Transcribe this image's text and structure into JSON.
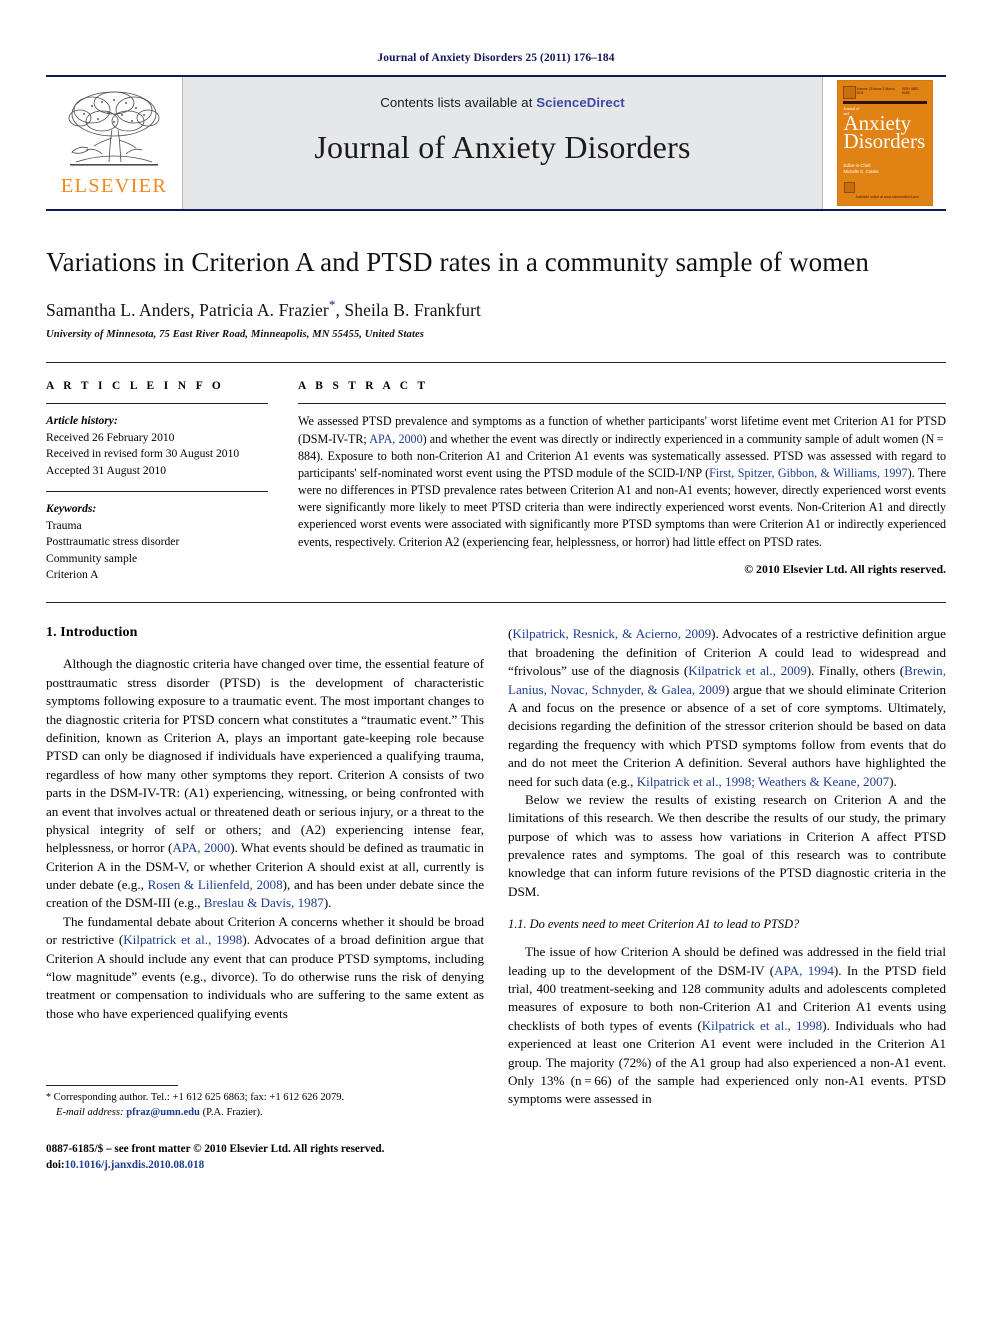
{
  "running_head": "Journal of Anxiety Disorders 25 (2011) 176–184",
  "masthead": {
    "contents_prefix": "Contents lists available at ",
    "sciencedirect": "ScienceDirect",
    "journal_title": "Journal of Anxiety Disorders",
    "publisher_logo_text": "ELSEVIER",
    "cover": {
      "top_left_meta": "Volume 25 Issue 2 March 2011",
      "top_right_meta": "ISSN 0887-6185",
      "kicker_line1": "Journal of",
      "kicker_line2": "and",
      "big_line1": "Anxiety",
      "big_line2": "Disorders",
      "editor_label": "Editor-in-Chief:",
      "editor_name": "Michelle G. Craske",
      "footer_text": "Available online at www.sciencedirect.com"
    }
  },
  "article": {
    "title": "Variations in Criterion A and PTSD rates in a community sample of women",
    "authors": "Samantha L. Anders, Patricia A. Frazier",
    "authors_tail": ", Sheila B. Frankfurt",
    "corresponding_marker": "*",
    "affiliation": "University of Minnesota, 75 East River Road, Minneapolis, MN 55455, United States"
  },
  "info": {
    "heading": "A R T I C L E  I N F O",
    "history_label": "Article history:",
    "history": [
      "Received 26 February 2010",
      "Received in revised form 30 August 2010",
      "Accepted 31 August 2010"
    ],
    "keywords_label": "Keywords:",
    "keywords": [
      "Trauma",
      "Posttraumatic stress disorder",
      "Community sample",
      "Criterion A"
    ]
  },
  "abstract": {
    "heading": "A B S T R A C T",
    "paragraph_1": "We assessed PTSD prevalence and symptoms as a function of whether participants' worst lifetime event met Criterion A1 for PTSD (DSM-IV-TR; ",
    "ref_apa_2000": "APA, 2000",
    "paragraph_2": ") and whether the event was directly or indirectly experienced in a community sample of adult women (N = 884). Exposure to both non-Criterion A1 and Criterion A1 events was systematically assessed. PTSD was assessed with regard to participants' self-nominated worst event using the PTSD module of the SCID-I/NP (",
    "ref_first_1997": "First, Spitzer, Gibbon, & Williams, 1997",
    "paragraph_3": "). There were no differences in PTSD prevalence rates between Criterion A1 and non-A1 events; however, directly experienced worst events were significantly more likely to meet PTSD criteria than were indirectly experienced worst events. Non-Criterion A1 and directly experienced worst events were associated with significantly more PTSD symptoms than were Criterion A1 or indirectly experienced events, respectively. Criterion A2 (experiencing fear, helplessness, or horror) had little effect on PTSD rates.",
    "copyright": "© 2010 Elsevier Ltd. All rights reserved."
  },
  "body": {
    "section_1_heading": "1. Introduction",
    "left_p1_a": "Although the diagnostic criteria have changed over time, the essential feature of posttraumatic stress disorder (PTSD) is the development of characteristic symptoms following exposure to a traumatic event. The most important changes to the diagnostic criteria for PTSD concern what constitutes a “traumatic event.” This definition, known as Criterion A, plays an important gate-keeping role because PTSD can only be diagnosed if individuals have experienced a qualifying trauma, regardless of how many other symptoms they report. Criterion A consists of two parts in the DSM-IV-TR: (A1) experiencing, witnessing, or being confronted with an event that involves actual or threatened death or serious injury, or a threat to the physical integrity of self or others; and (A2) experiencing intense fear, helplessness, or horror (",
    "left_p1_ref1": "APA, 2000",
    "left_p1_b": "). What events should be defined as traumatic in Criterion A in the DSM-V, or whether Criterion A should exist at all, currently is under debate (e.g., ",
    "left_p1_ref2": "Rosen & Lilienfeld, 2008",
    "left_p1_c": "), and has been under debate since the creation of the DSM-III (e.g., ",
    "left_p1_ref3": "Breslau & Davis, 1987",
    "left_p1_d": ").",
    "left_p2_a": "The fundamental debate about Criterion A concerns whether it should be broad or restrictive (",
    "left_p2_ref1": "Kilpatrick et al., 1998",
    "left_p2_b": "). Advocates of a broad definition argue that Criterion A should include any event that can produce PTSD symptoms, including “low magnitude” events (e.g., divorce). To do otherwise runs the risk of denying treatment or compensation to individuals who are suffering to the same extent as those who have experienced qualifying events",
    "right_p1_ref1": "Kilpatrick, Resnick, & Acierno, 2009",
    "right_p1_a": "(",
    "right_p1_b": "). Advocates of a restrictive definition argue that broadening the definition of Criterion A could lead to widespread and “frivolous” use of the diagnosis (",
    "right_p1_ref2": "Kilpatrick et al., 2009",
    "right_p1_c": "). Finally, others (",
    "right_p1_ref3": "Brewin, Lanius, Novac, Schnyder, & Galea, 2009",
    "right_p1_d": ") argue that we should eliminate Criterion A and focus on the presence or absence of a set of core symptoms. Ultimately, decisions regarding the definition of the stressor criterion should be based on data regarding the frequency with which PTSD symptoms follow from events that do and do not meet the Criterion A definition. Several authors have highlighted the need for such data (e.g., ",
    "right_p1_ref4": "Kilpatrick et al., 1998; Weathers & Keane, 2007",
    "right_p1_e": ").",
    "right_p2": "Below we review the results of existing research on Criterion A and the limitations of this research. We then describe the results of our study, the primary purpose of which was to assess how variations in Criterion A affect PTSD prevalence rates and symptoms. The goal of this research was to contribute knowledge that can inform future revisions of the PTSD diagnostic criteria in the DSM.",
    "subsection_1_1": "1.1.  Do events need to meet Criterion A1 to lead to PTSD?",
    "right_p3_a": "The issue of how Criterion A should be defined was addressed in the field trial leading up to the development of the DSM-IV (",
    "right_p3_ref1": "APA, 1994",
    "right_p3_b": "). In the PTSD field trial, 400 treatment-seeking and 128 community adults and adolescents completed measures of exposure to both non-Criterion A1 and Criterion A1 events using checklists of both types of events (",
    "right_p3_ref2": "Kilpatrick et al., 1998",
    "right_p3_c": "). Individuals who had experienced at least one Criterion A1 event were included in the Criterion A1 group. The majority (72%) of the A1 group had also experienced a non-A1 event. Only 13% (n = 66) of the sample had experienced only non-A1 events. PTSD symptoms were assessed in"
  },
  "footnotes": {
    "corresponding_marker": "*",
    "corresponding": " Corresponding author. Tel.: +1 612 625 6863; fax: +1 612 626 2079.",
    "email_label": "E-mail address:",
    "email": "pfraz@umn.edu",
    "email_suffix": " (P.A. Frazier).",
    "issn_line": "0887-6185/$ – see front matter © 2010 Elsevier Ltd. All rights reserved.",
    "doi_label": "doi:",
    "doi_value": "10.1016/j.janxdis.2010.08.018"
  },
  "colors": {
    "header_navy": "#14165a",
    "link_blue": "#1f3d8f",
    "elsevier_orange": "#f08a1e",
    "cover_orange": "#e08214",
    "masthead_gray": "#e6e7e9"
  }
}
